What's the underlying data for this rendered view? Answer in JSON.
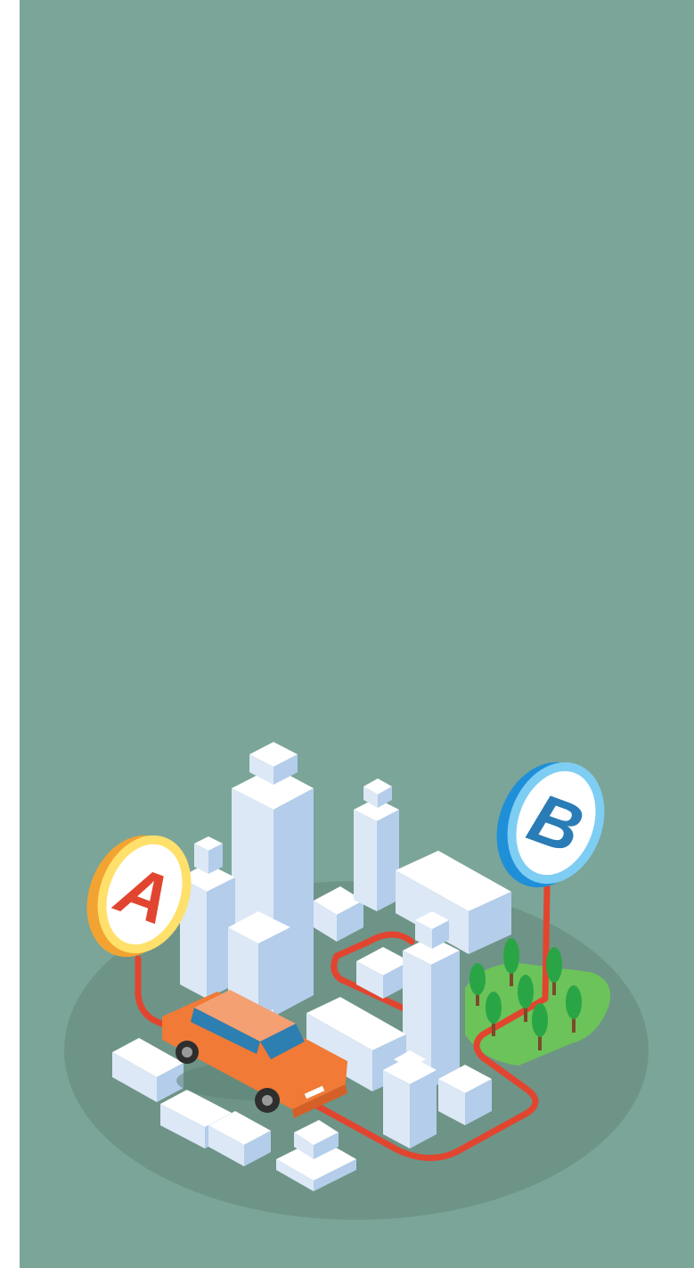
{
  "illustration": {
    "colors": {
      "background": "#7BA598",
      "ground": "#6E9487",
      "route": "#E2452F",
      "building_top": "#FFFFFF",
      "building_left": "#DCE8F5",
      "building_right": "#B3CDEB",
      "car_body": "#F07A36",
      "car_roof": "#F4A072",
      "car_glass": "#2D7EB1",
      "park": "#6CC359",
      "tree": "#2AA546",
      "trunk": "#7A4A2B"
    },
    "markers": [
      {
        "letter": "A",
        "color": "#E2452F",
        "ring": "#FFE06A",
        "rim": "#F2A332"
      },
      {
        "letter": "B",
        "color": "#2A7CB6",
        "ring": "#7ECDF3",
        "rim": "#1F8FD8"
      }
    ]
  }
}
